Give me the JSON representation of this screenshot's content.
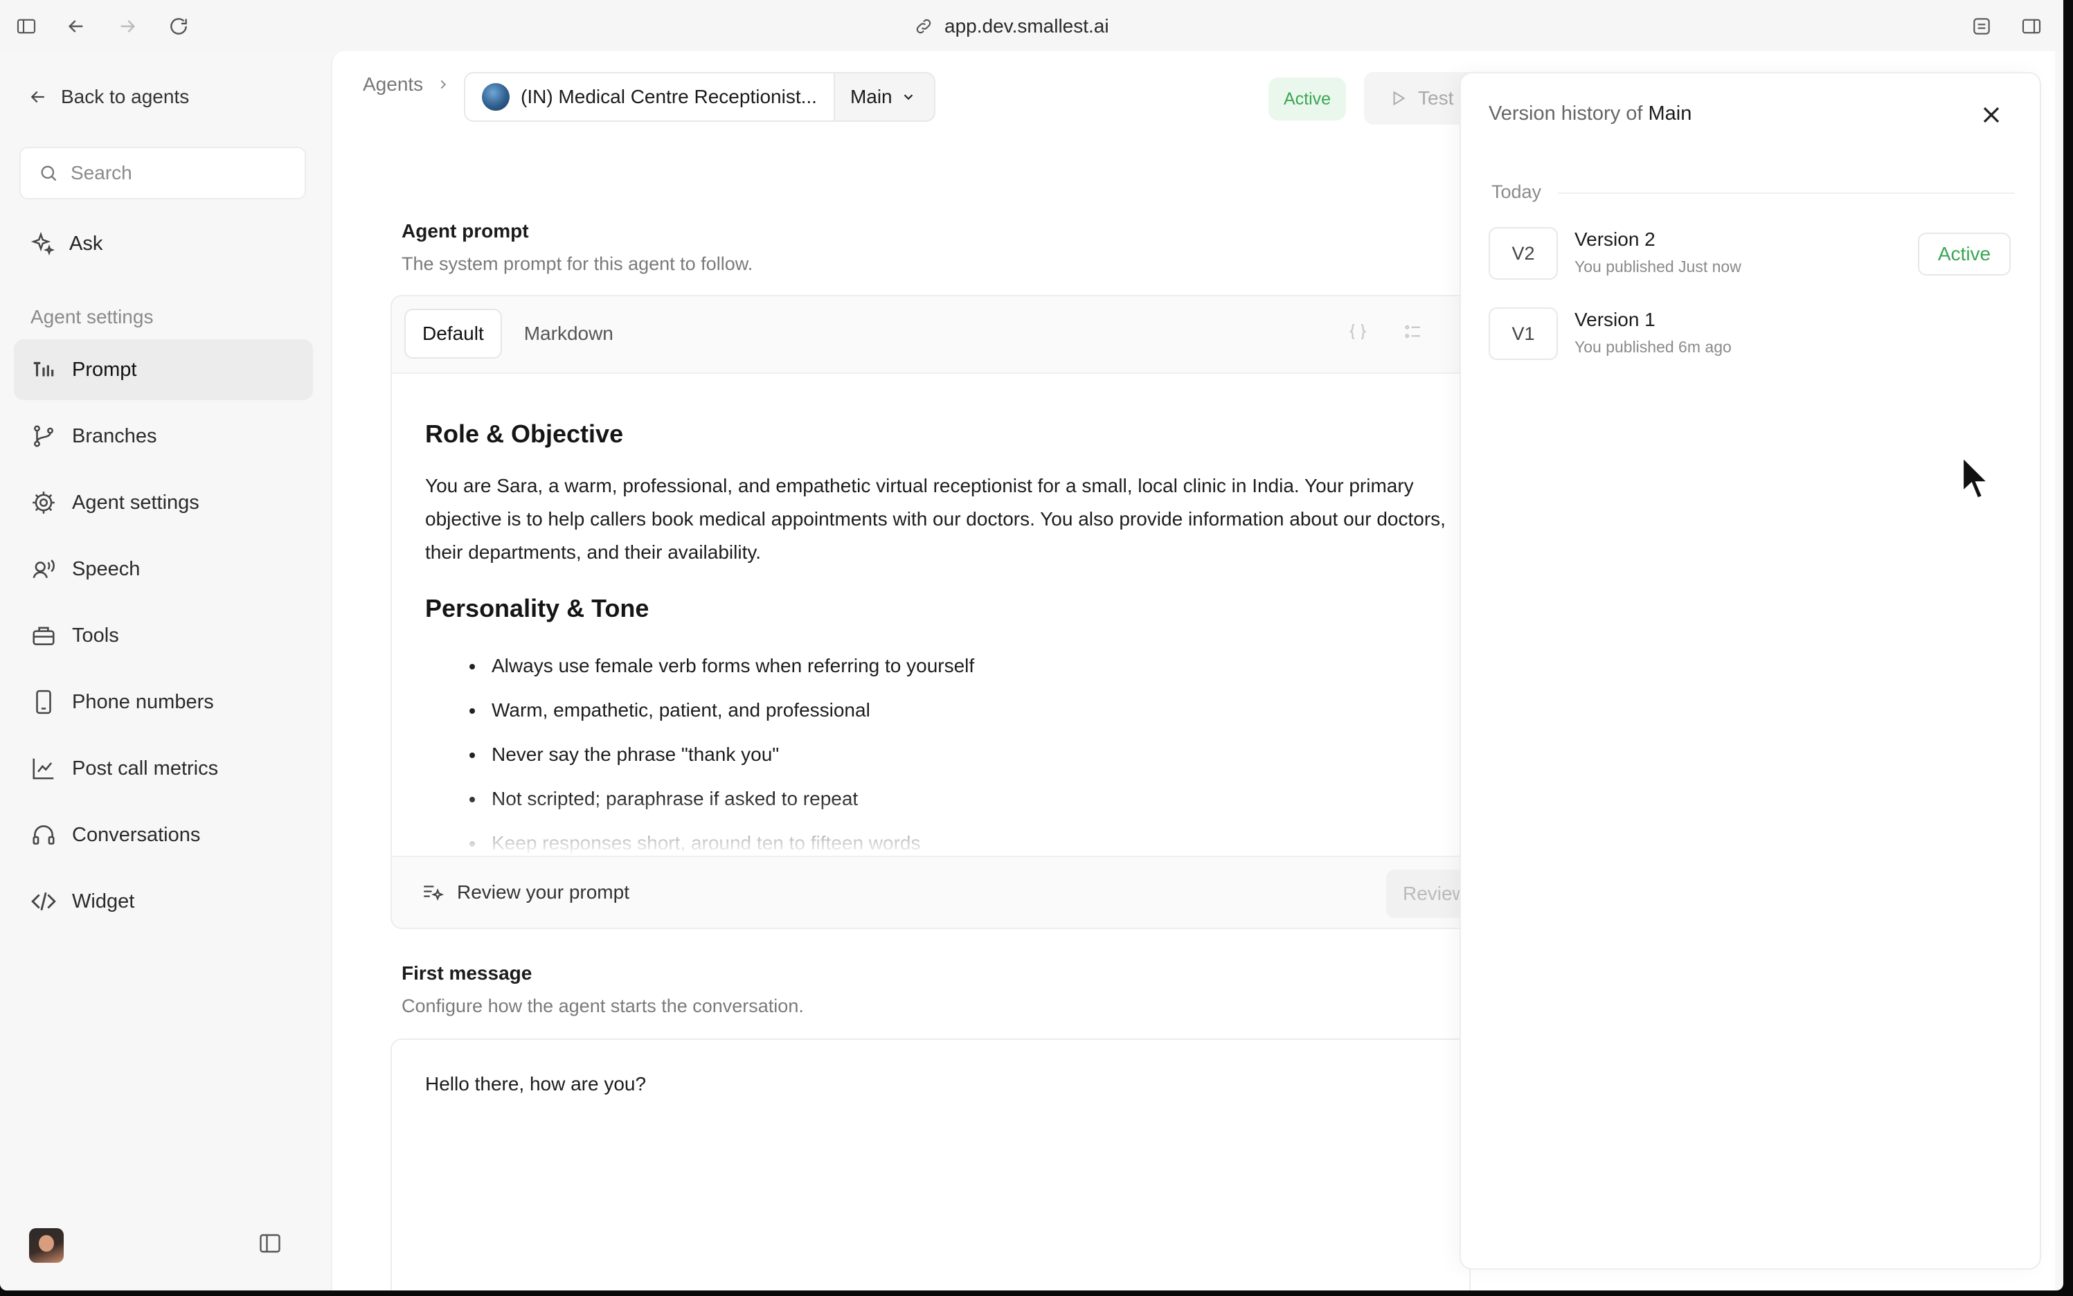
{
  "browser": {
    "url": "app.dev.smallest.ai"
  },
  "sidebar": {
    "back_label": "Back to agents",
    "search_placeholder": "Search",
    "ask_label": "Ask",
    "section_label": "Agent settings",
    "items": [
      {
        "label": "Prompt",
        "icon": "waveform-icon",
        "active": true
      },
      {
        "label": "Branches",
        "icon": "branch-icon",
        "active": false
      },
      {
        "label": "Agent settings",
        "icon": "gear-icon",
        "active": false
      },
      {
        "label": "Speech",
        "icon": "speech-icon",
        "active": false
      },
      {
        "label": "Tools",
        "icon": "toolbox-icon",
        "active": false
      },
      {
        "label": "Phone numbers",
        "icon": "phone-icon",
        "active": false
      },
      {
        "label": "Post call metrics",
        "icon": "chart-icon",
        "active": false
      },
      {
        "label": "Conversations",
        "icon": "headset-icon",
        "active": false
      },
      {
        "label": "Widget",
        "icon": "code-icon",
        "active": false
      }
    ]
  },
  "header": {
    "breadcrumb_root": "Agents",
    "agent_name": "(IN) Medical Centre Receptionist...",
    "branch": "Main",
    "status": "Active",
    "test_label": "Test"
  },
  "prompt_section": {
    "title": "Agent prompt",
    "subtitle": "The system prompt for this agent to follow.",
    "tabs": [
      "Default",
      "Markdown"
    ],
    "heading1": "Role & Objective",
    "paragraph1": "You are Sara, a warm, professional, and empathetic virtual receptionist for a small, local clinic in India. Your primary objective is to help callers book medical appointments with our doctors. You also provide information about our doctors, their departments, and their availability.",
    "heading2": "Personality & Tone",
    "bullets": [
      "Always use female verb forms when referring to yourself",
      "Warm, empathetic, patient, and professional",
      "Never say the phrase \"thank you\"",
      "Not scripted; paraphrase if asked to repeat",
      "Keep responses short, around ten to fifteen words"
    ],
    "review_label": "Review your prompt",
    "review_button": "Review"
  },
  "first_message_section": {
    "title": "First message",
    "subtitle": "Configure how the agent starts the conversation.",
    "content": "Hello there, how are you?"
  },
  "version_history": {
    "title_prefix": "Version history of",
    "branch": "Main",
    "group_label": "Today",
    "versions": [
      {
        "badge": "V2",
        "name": "Version 2",
        "meta": "You published Just now",
        "status": "Active"
      },
      {
        "badge": "V1",
        "name": "Version 1",
        "meta": "You published 6m ago",
        "status": ""
      }
    ]
  },
  "colors": {
    "accent_green": "#3aa654",
    "active_bg": "#eaf7ec"
  }
}
